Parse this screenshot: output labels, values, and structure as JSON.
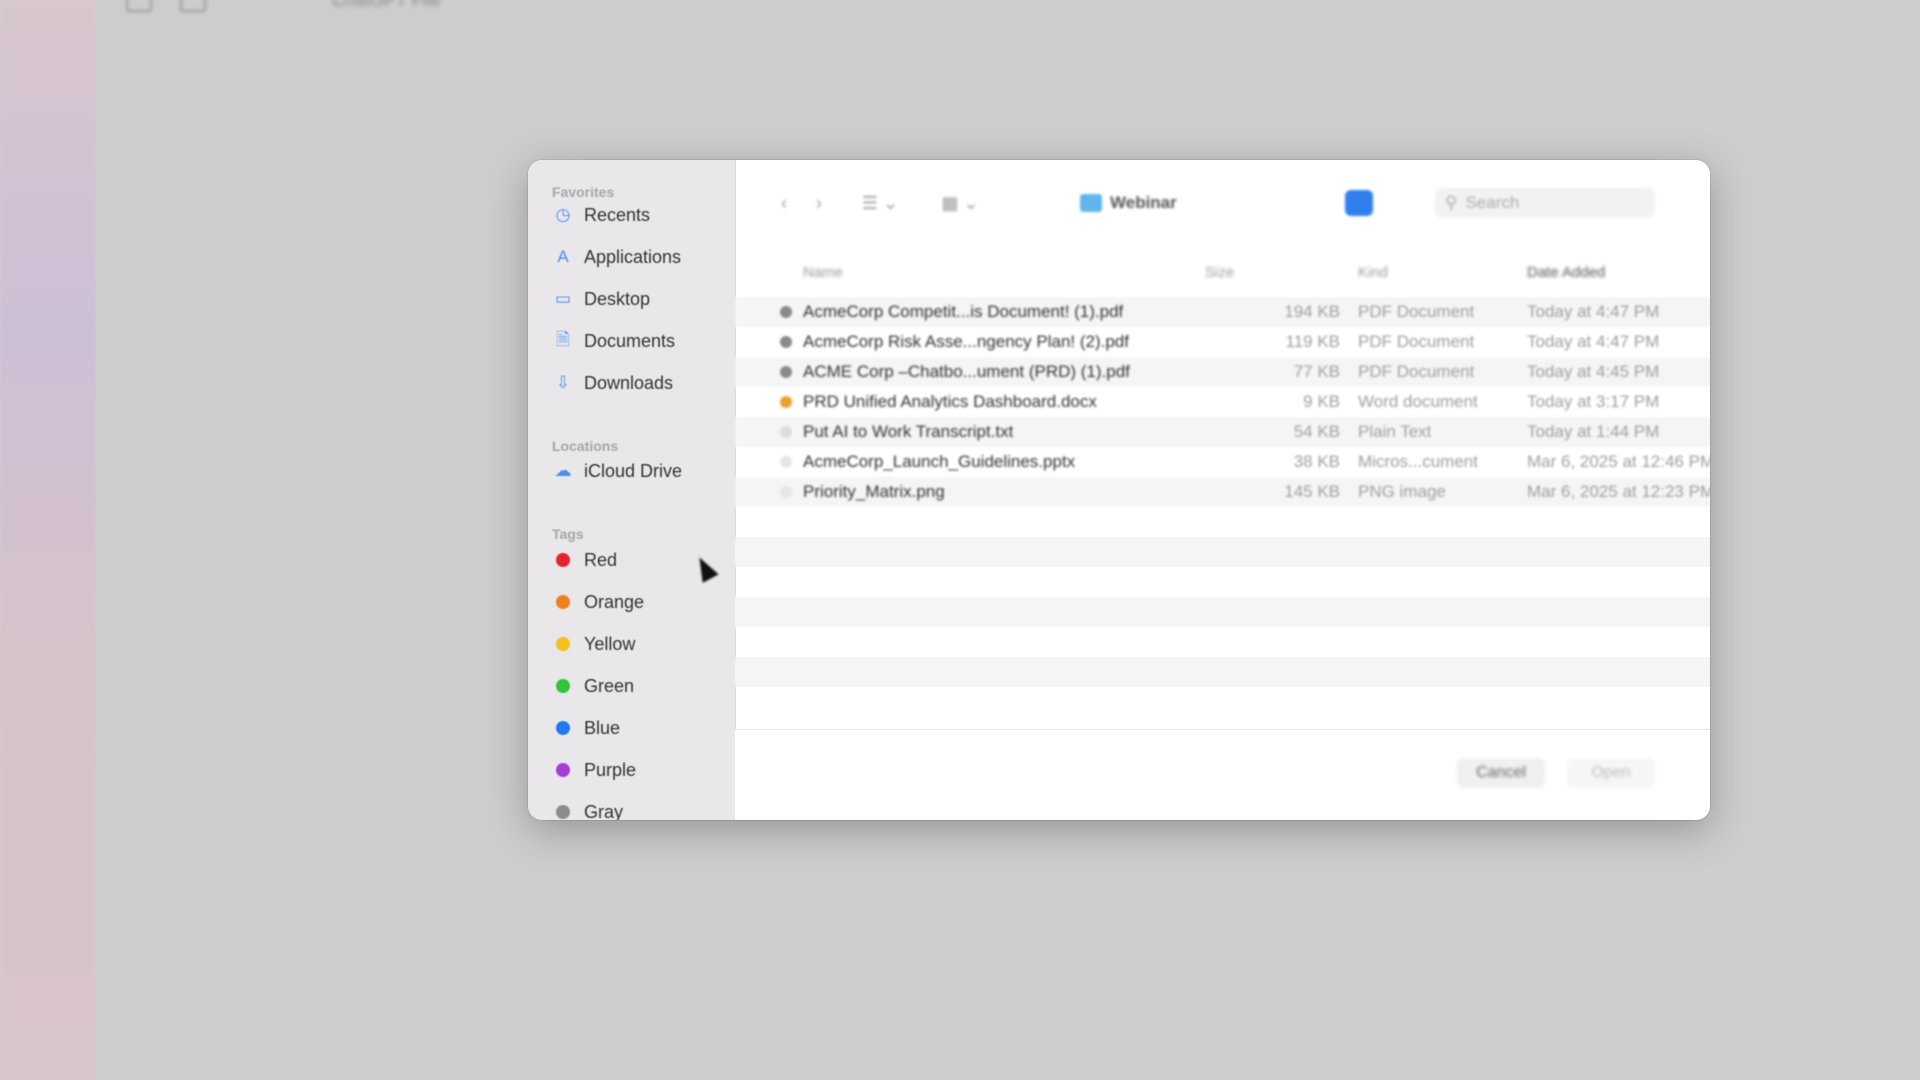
{
  "app": {
    "title": "ChatGPT File"
  },
  "sidebar": {
    "favorites_heading": "Favorites",
    "favorites": [
      {
        "label": "Recents",
        "icon": "clock-icon"
      },
      {
        "label": "Applications",
        "icon": "applications-icon"
      },
      {
        "label": "Desktop",
        "icon": "desktop-icon"
      },
      {
        "label": "Documents",
        "icon": "document-icon"
      },
      {
        "label": "Downloads",
        "icon": "download-icon"
      }
    ],
    "locations_heading": "Locations",
    "locations": [
      {
        "label": "iCloud Drive",
        "icon": "cloud-icon"
      }
    ],
    "tags_heading": "Tags",
    "tags": [
      {
        "label": "Red",
        "color": "#e5232e"
      },
      {
        "label": "Orange",
        "color": "#f0801e"
      },
      {
        "label": "Yellow",
        "color": "#f4c01d"
      },
      {
        "label": "Green",
        "color": "#32c43a"
      },
      {
        "label": "Blue",
        "color": "#1f79f1"
      },
      {
        "label": "Purple",
        "color": "#a53fd2"
      },
      {
        "label": "Gray",
        "color": "#8c8c8c"
      }
    ]
  },
  "toolbar": {
    "back_icon": "chevron-left-icon",
    "forward_icon": "chevron-right-icon",
    "view_icon": "list-view-icon",
    "group_icon": "grid-view-icon",
    "folder_name": "Webinar",
    "search_placeholder": "Search"
  },
  "columns": {
    "name": "Name",
    "size": "Size",
    "kind": "Kind",
    "date": "Date Added"
  },
  "files": [
    {
      "name": "AcmeCorp Competit...is Document! (1).pdf",
      "size": "194 KB",
      "kind": "PDF Document",
      "date": "Today at 4:47 PM",
      "icon_color": "#8a8a8a"
    },
    {
      "name": "AcmeCorp Risk Asse...ngency Plan! (2).pdf",
      "size": "119 KB",
      "kind": "PDF Document",
      "date": "Today at 4:47 PM",
      "icon_color": "#8a8a8a"
    },
    {
      "name": "ACME Corp –Chatbo...ument (PRD) (1).pdf",
      "size": "77 KB",
      "kind": "PDF Document",
      "date": "Today at 4:45 PM",
      "icon_color": "#8a8a8a"
    },
    {
      "name": "PRD Unified Analytics Dashboard.docx",
      "size": "9 KB",
      "kind": "Word document",
      "date": "Today at 3:17 PM",
      "icon_color": "#f0a030"
    },
    {
      "name": "Put AI to Work Transcript.txt",
      "size": "54 KB",
      "kind": "Plain Text",
      "date": "Today at 1:44 PM",
      "icon_color": "#dddddd"
    },
    {
      "name": "AcmeCorp_Launch_Guidelines.pptx",
      "size": "38 KB",
      "kind": "Micros...cument",
      "date": "Mar 6, 2025 at 12:46 PM",
      "icon_color": "#e6e6e6"
    },
    {
      "name": "Priority_Matrix.png",
      "size": "145 KB",
      "kind": "PNG image",
      "date": "Mar 6, 2025 at 12:23 PM",
      "icon_color": "#e6e6e6"
    }
  ],
  "footer": {
    "cancel_label": "Cancel",
    "open_label": "Open"
  }
}
